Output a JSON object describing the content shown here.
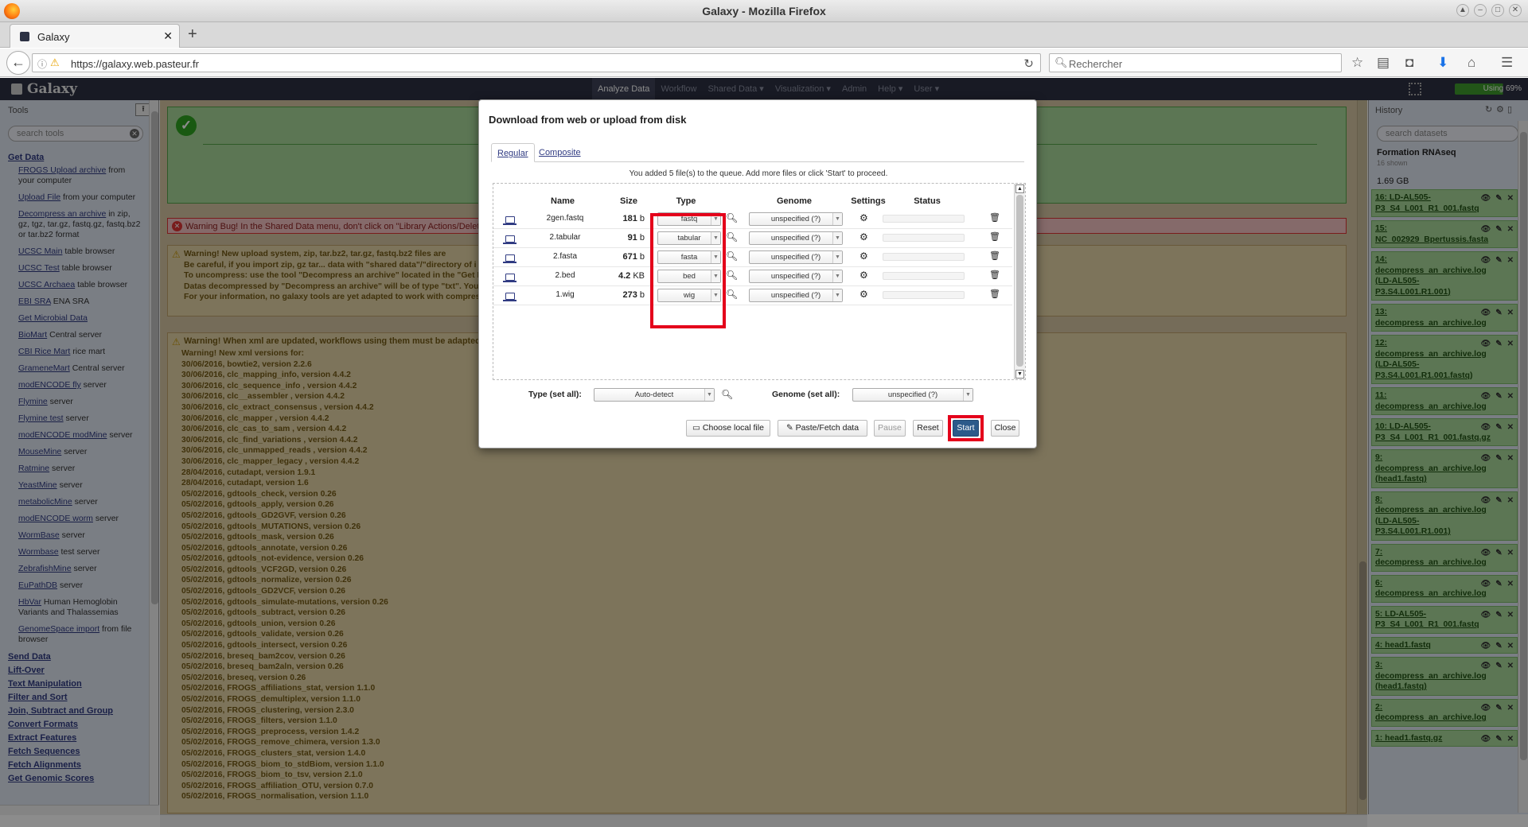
{
  "window": {
    "title": "Galaxy - Mozilla Firefox"
  },
  "browser": {
    "tab_title": "Galaxy",
    "url": "https://galaxy.web.pasteur.fr",
    "search_placeholder": "Rechercher"
  },
  "galaxy": {
    "brand": "Galaxy",
    "menu": [
      {
        "label": "Analyze Data",
        "active": true
      },
      {
        "label": "Workflow"
      },
      {
        "label": "Shared Data ▾"
      },
      {
        "label": "Visualization ▾"
      },
      {
        "label": "Admin"
      },
      {
        "label": "Help ▾"
      },
      {
        "label": "User ▾"
      }
    ],
    "quota_label": "Using 69%",
    "quota_percent": 69
  },
  "tools": {
    "header": "Tools",
    "search_placeholder": "search tools",
    "items": [
      {
        "kind": "section",
        "label": "Get Data"
      },
      {
        "kind": "tool",
        "link": "FROGS Upload archive",
        "rest": " from your computer"
      },
      {
        "kind": "tool",
        "link": "Upload File",
        "rest": " from your computer"
      },
      {
        "kind": "tool",
        "link": "Decompress an archive",
        "rest": " in zip, gz, tgz, tar.gz, fastq.gz, fastq.bz2 or tar.bz2 format"
      },
      {
        "kind": "tool",
        "link": "UCSC Main",
        "rest": " table browser"
      },
      {
        "kind": "tool",
        "link": "UCSC Test",
        "rest": " table browser"
      },
      {
        "kind": "tool",
        "link": "UCSC Archaea",
        "rest": " table browser"
      },
      {
        "kind": "tool",
        "link": "EBI SRA",
        "rest": " ENA SRA"
      },
      {
        "kind": "tool",
        "link": "Get Microbial Data",
        "rest": ""
      },
      {
        "kind": "tool",
        "link": "BioMart",
        "rest": " Central server"
      },
      {
        "kind": "tool",
        "link": "CBI Rice Mart",
        "rest": " rice mart"
      },
      {
        "kind": "tool",
        "link": "GrameneMart",
        "rest": " Central server"
      },
      {
        "kind": "tool",
        "link": "modENCODE fly",
        "rest": " server"
      },
      {
        "kind": "tool",
        "link": "Flymine",
        "rest": " server"
      },
      {
        "kind": "tool",
        "link": "Flymine test",
        "rest": " server"
      },
      {
        "kind": "tool",
        "link": "modENCODE modMine",
        "rest": " server"
      },
      {
        "kind": "tool",
        "link": "MouseMine",
        "rest": " server"
      },
      {
        "kind": "tool",
        "link": "Ratmine",
        "rest": " server"
      },
      {
        "kind": "tool",
        "link": "YeastMine",
        "rest": " server"
      },
      {
        "kind": "tool",
        "link": "metabolicMine",
        "rest": " server"
      },
      {
        "kind": "tool",
        "link": "modENCODE worm",
        "rest": " server"
      },
      {
        "kind": "tool",
        "link": "WormBase",
        "rest": " server"
      },
      {
        "kind": "tool",
        "link": "Wormbase",
        "rest": " test server"
      },
      {
        "kind": "tool",
        "link": "ZebrafishMine",
        "rest": " server"
      },
      {
        "kind": "tool",
        "link": "EuPathDB",
        "rest": " server"
      },
      {
        "kind": "tool",
        "link": "HbVar",
        "rest": " Human Hemoglobin Variants and Thalassemias"
      },
      {
        "kind": "tool",
        "link": "GenomeSpace import",
        "rest": " from file browser"
      },
      {
        "kind": "section",
        "label": "Send Data"
      },
      {
        "kind": "section",
        "label": "Lift-Over"
      },
      {
        "kind": "section",
        "label": "Text Manipulation"
      },
      {
        "kind": "section",
        "label": "Filter and Sort"
      },
      {
        "kind": "section",
        "label": "Join, Subtract and Group"
      },
      {
        "kind": "section",
        "label": "Convert Formats"
      },
      {
        "kind": "section",
        "label": "Extract Features"
      },
      {
        "kind": "section",
        "label": "Fetch Sequences"
      },
      {
        "kind": "section",
        "label": "Fetch Alignments"
      },
      {
        "kind": "section",
        "label": "Get Genomic Scores"
      }
    ]
  },
  "center": {
    "error_text": "Warning Bug! In the Shared Data menu, don't click on \"Library Actions/Delete th",
    "warning1": [
      "Warning! New upload system, zip, tar.bz2, tar.gz, fastq.bz2 files are",
      "Be careful, if you import zip, gz tar... data with \"shared data\"/\"directory of i",
      "To uncompress: use the tool \"Decompress an archive\" located in the \"Get D",
      "Datas decompressed by \"Decompress an archive\" will be of type \"txt\". You",
      "For your information, no galaxy tools are yet adapted to work with compres"
    ],
    "warning2_title": "Warning! When xml are updated, workflows using them must be adapted.",
    "warning2": [
      "Warning! New xml versions for:",
      "30/06/2016, bowtie2, version 2.2.6",
      "30/06/2016, clc_mapping_info, version 4.4.2",
      "30/06/2016, clc_sequence_info , version 4.4.2",
      "30/06/2016, clc__assembler , version 4.4.2",
      "30/06/2016, clc_extract_consensus , version 4.4.2",
      "30/06/2016, clc_mapper , version 4.4.2",
      "30/06/2016, clc_cas_to_sam , version 4.4.2",
      "30/06/2016, clc_find_variations , version 4.4.2",
      "30/06/2016, clc_unmapped_reads , version 4.4.2",
      "30/06/2016, clc_mapper_legacy , version 4.4.2",
      "28/04/2016, cutadapt, version 1.9.1",
      "28/04/2016, cutadapt, version 1.6",
      "05/02/2016, gdtools_check, version 0.26",
      "05/02/2016, gdtools_apply, version 0.26",
      "05/02/2016, gdtools_GD2GVF, version 0.26",
      "05/02/2016, gdtools_MUTATIONS, version 0.26",
      "05/02/2016, gdtools_mask, version 0.26",
      "05/02/2016, gdtools_annotate, version 0.26",
      "05/02/2016, gdtools_not-evidence, version 0.26",
      "05/02/2016, gdtools_VCF2GD, version 0.26",
      "05/02/2016, gdtools_normalize, version 0.26",
      "05/02/2016, gdtools_GD2VCF, version 0.26",
      "05/02/2016, gdtools_simulate-mutations, version 0.26",
      "05/02/2016, gdtools_subtract, version 0.26",
      "05/02/2016, gdtools_union, version 0.26",
      "05/02/2016, gdtools_validate, version 0.26",
      "05/02/2016, gdtools_intersect, version 0.26",
      "05/02/2016, breseq_bam2cov, version 0.26",
      "05/02/2016, breseq_bam2aln, version 0.26",
      "05/02/2016, breseq, version 0.26",
      "05/02/2016, FROGS_affiliations_stat, version 1.1.0",
      "05/02/2016, FROGS_demultiplex, version 1.1.0",
      "05/02/2016, FROGS_clustering, version 2.3.0",
      "05/02/2016, FROGS_filters, version 1.1.0",
      "05/02/2016, FROGS_preprocess, version 1.4.2",
      "05/02/2016, FROGS_remove_chimera, version 1.3.0",
      "05/02/2016, FROGS_clusters_stat, version 1.4.0",
      "05/02/2016, FROGS_biom_to_stdBiom, version 1.1.0",
      "05/02/2016, FROGS_biom_to_tsv, version 2.1.0",
      "05/02/2016, FROGS_affiliation_OTU, version 0.7.0",
      "05/02/2016, FROGS_normalisation, version 1.1.0"
    ]
  },
  "history": {
    "header": "History",
    "search_placeholder": "search datasets",
    "name": "Formation RNAseq",
    "shown": "16 shown",
    "size": "1.69 GB",
    "items": [
      "16: LD-AL505-P3_S4_L001_R1_001.fastq",
      "15: NC_002929_Bpertussis.fasta",
      "14: decompress_an_archive.log (LD-AL505-P3.S4.L001.R1.001)",
      "13: decompress_an_archive.log",
      "12: decompress_an_archive.log (LD-AL505-P3.S4.L001.R1.001.fastq)",
      "11: decompress_an_archive.log",
      "10: LD-AL505-P3_S4_L001_R1_001.fastq.gz",
      "9: decompress_an_archive.log (head1.fastq)",
      "8: decompress_an_archive.log (LD-AL505-P3.S4.L001.R1.001)",
      "7: decompress_an_archive.log",
      "6: decompress_an_archive.log",
      "5: LD-AL505-P3_S4_L001_R1_001.fastq",
      "4: head1.fastq",
      "3: decompress_an_archive.log (head1.fastq)",
      "2: decompress_an_archive.log",
      "1: head1.fastq.gz"
    ]
  },
  "upload_dialog": {
    "title": "Download from web or upload from disk",
    "tabs": [
      "Regular",
      "Composite"
    ],
    "queue_message": "You added 5 file(s) to the queue. Add more files or click 'Start' to proceed.",
    "columns": [
      "Name",
      "Size",
      "Type",
      "Genome",
      "Settings",
      "Status"
    ],
    "files": [
      {
        "name": "2gen.fastq",
        "size_num": "181",
        "size_unit": "b",
        "type": "fastq",
        "genome": "unspecified (?)"
      },
      {
        "name": "2.tabular",
        "size_num": "91",
        "size_unit": "b",
        "type": "tabular",
        "genome": "unspecified (?)"
      },
      {
        "name": "2.fasta",
        "size_num": "671",
        "size_unit": "b",
        "type": "fasta",
        "genome": "unspecified (?)"
      },
      {
        "name": "2.bed",
        "size_num": "4.2",
        "size_unit": "KB",
        "type": "bed",
        "genome": "unspecified (?)"
      },
      {
        "name": "1.wig",
        "size_num": "273",
        "size_unit": "b",
        "type": "wig",
        "genome": "unspecified (?)"
      }
    ],
    "type_set_all_label": "Type (set all):",
    "type_set_all_value": "Auto-detect",
    "genome_set_all_label": "Genome (set all):",
    "genome_set_all_value": "unspecified (?)",
    "buttons": {
      "choose_local": "Choose local file",
      "paste_fetch": "Paste/Fetch data",
      "pause": "Pause",
      "reset": "Reset",
      "start": "Start",
      "close": "Close"
    }
  },
  "colors": {
    "masthead": "#2c3143",
    "highlight": "#e4001b",
    "ok": "#a8d89a",
    "warning": "#e4d3a6"
  }
}
